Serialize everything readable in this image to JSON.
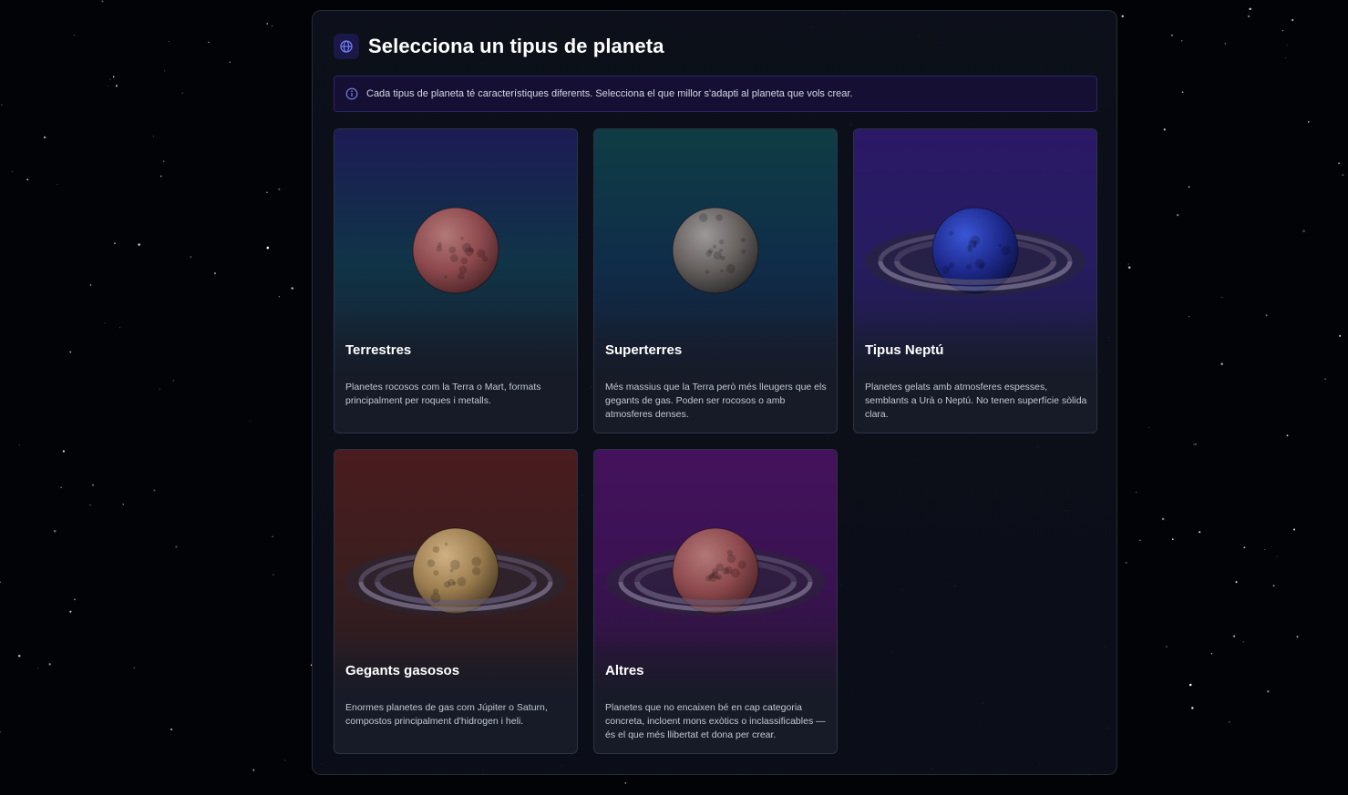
{
  "header": {
    "title": "Selecciona un tipus de planeta",
    "icon": "globe-icon"
  },
  "info": {
    "icon": "info-icon",
    "text": "Cada tipus de planeta té característiques diferents. Selecciona el que millor s'adapti al planeta que vols crear."
  },
  "planet_types": [
    {
      "name": "Terrestres",
      "description": "Planetes rocosos com la Terra o Mart, formats principalment per roques i metalls.",
      "bg_colors": [
        "#1c1b55",
        "#103447",
        "#171f2f"
      ],
      "planet_colors": [
        "#b27878",
        "#8e4a4e",
        "#4b2427"
      ],
      "rings": false
    },
    {
      "name": "Superterres",
      "description": "Més massius que la Terra però més lleugers que els gegants de gas. Poden ser rocosos o amb atmosferes denses.",
      "bg_colors": [
        "#0f3d44",
        "#0f2d49",
        "#171c31"
      ],
      "planet_colors": [
        "#9c9898",
        "#66615f",
        "#2c2a2b"
      ],
      "rings": false
    },
    {
      "name": "Tipus Neptú",
      "description": "Planetes gelats amb atmosferes espesses, semblants a Urà o Neptú. No tenen superfície sòlida clara.",
      "bg_colors": [
        "#2b1866",
        "#261c61",
        "#1c1c3d"
      ],
      "planet_colors": [
        "#3a56d6",
        "#1f2b8f",
        "#0a1140"
      ],
      "rings": true
    },
    {
      "name": "Gegants gasosos",
      "description": "Enormes planetes de gas com Júpiter o Saturn, compostos principalment d'hidrogen i heli.",
      "bg_colors": [
        "#4a1c1f",
        "#3a1e1f",
        "#231a22"
      ],
      "planet_colors": [
        "#cfb183",
        "#9b7d4f",
        "#4a3822"
      ],
      "rings": true
    },
    {
      "name": "Altres",
      "description": "Planetes que no encaixen bé en cap categoria concreta, incloent mons exòtics o inclassificables — és el que més llibertat et dona per crear.",
      "bg_colors": [
        "#44125c",
        "#3a1252",
        "#261632"
      ],
      "planet_colors": [
        "#b27878",
        "#8e4a4e",
        "#4b2427"
      ],
      "rings": true
    }
  ]
}
